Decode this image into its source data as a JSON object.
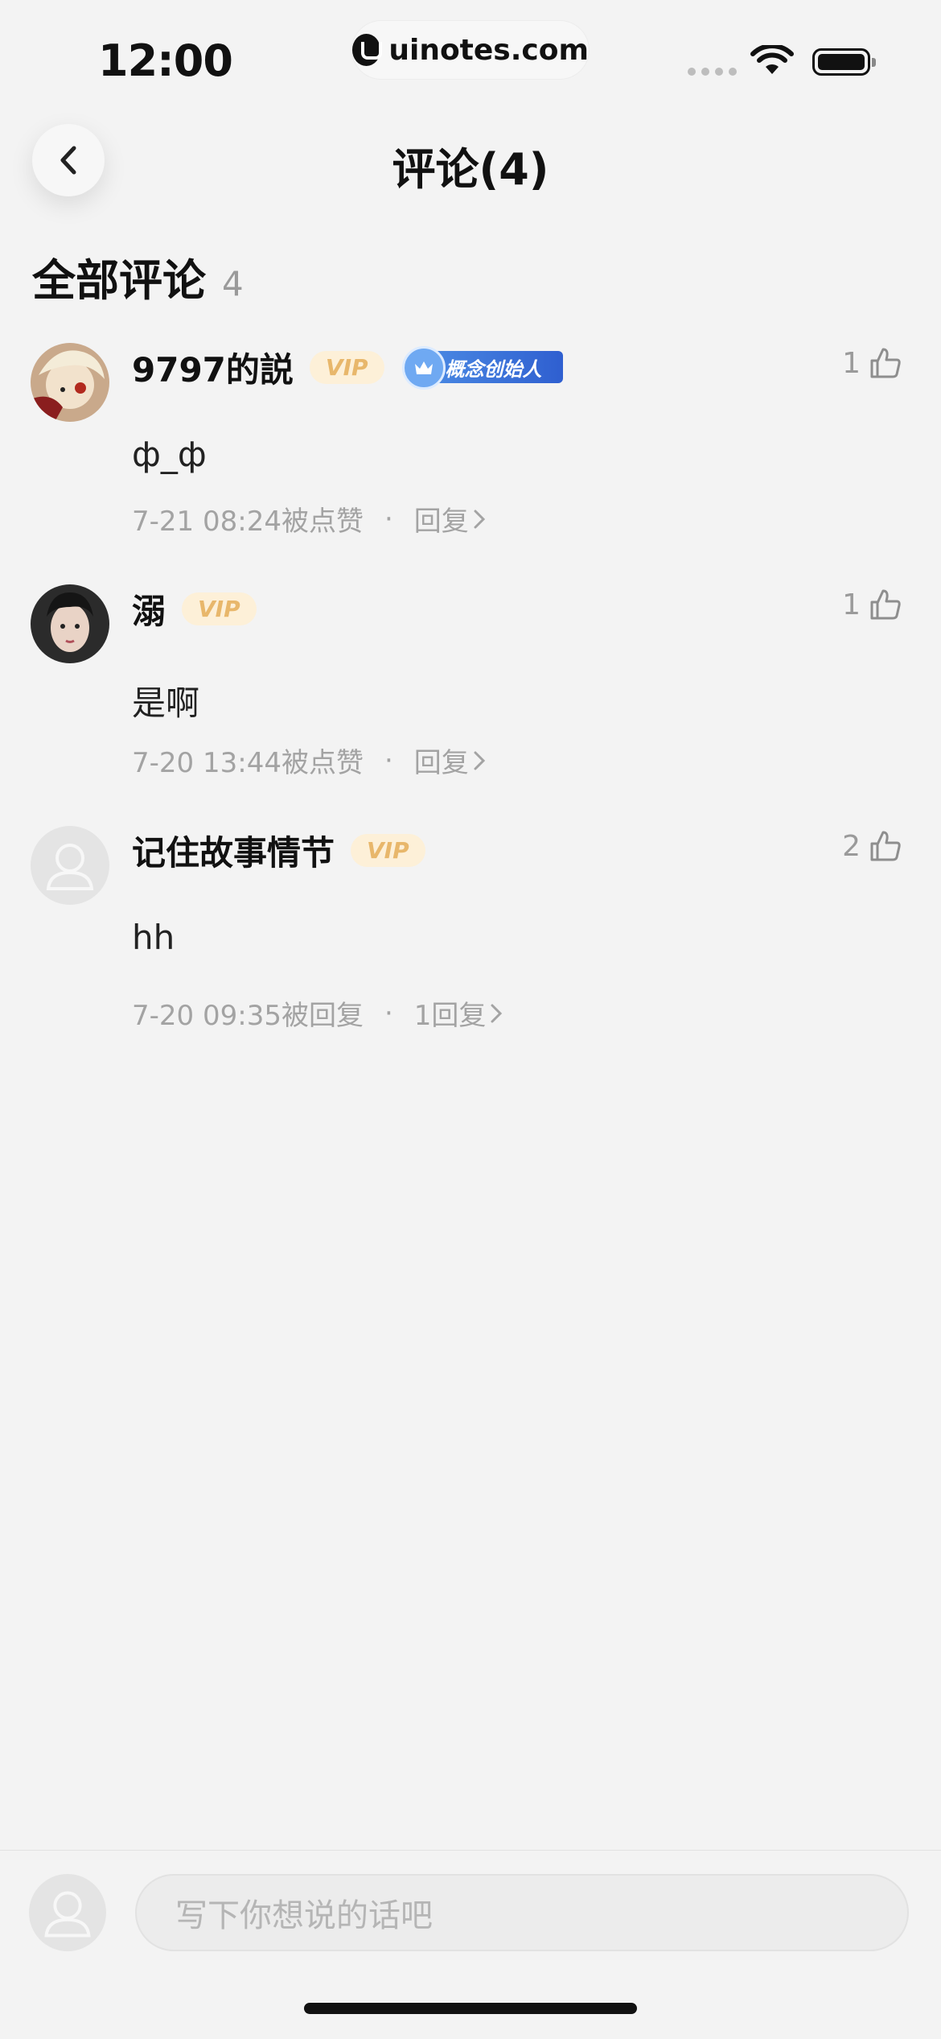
{
  "status_bar": {
    "time": "12:00",
    "url": "uinotes.com"
  },
  "nav": {
    "title": "评论(4)"
  },
  "section": {
    "title": "全部评论",
    "count": "4"
  },
  "comments": [
    {
      "username": "9797的説",
      "vip": "VIP",
      "badge": "概念创始人",
      "likes": "1",
      "text": "ф_ф",
      "time": "7-21 08:24被点赞",
      "dot": "·",
      "reply": "回复"
    },
    {
      "username": "溺",
      "vip": "VIP",
      "likes": "1",
      "text": "是啊",
      "time": "7-20 13:44被点赞",
      "dot": "·",
      "reply": "回复"
    },
    {
      "username": "记住故事情节",
      "vip": "VIP",
      "likes": "2",
      "text": "hh",
      "time": "7-20 09:35被回复",
      "dot": "·",
      "reply": "1回复"
    }
  ],
  "composer": {
    "placeholder": "写下你想说的话吧"
  },
  "colors": {
    "background": "#f3f3f3",
    "vip_text": "#e8b76b",
    "vip_bg": "#fdf0d8",
    "badge_blue": "#2f5fd0",
    "meta_gray": "#a3a3a3"
  },
  "icons": [
    "back-chevron-icon",
    "thumbs-up-icon",
    "chevron-right-icon",
    "crown-icon",
    "wifi-icon",
    "battery-icon"
  ]
}
